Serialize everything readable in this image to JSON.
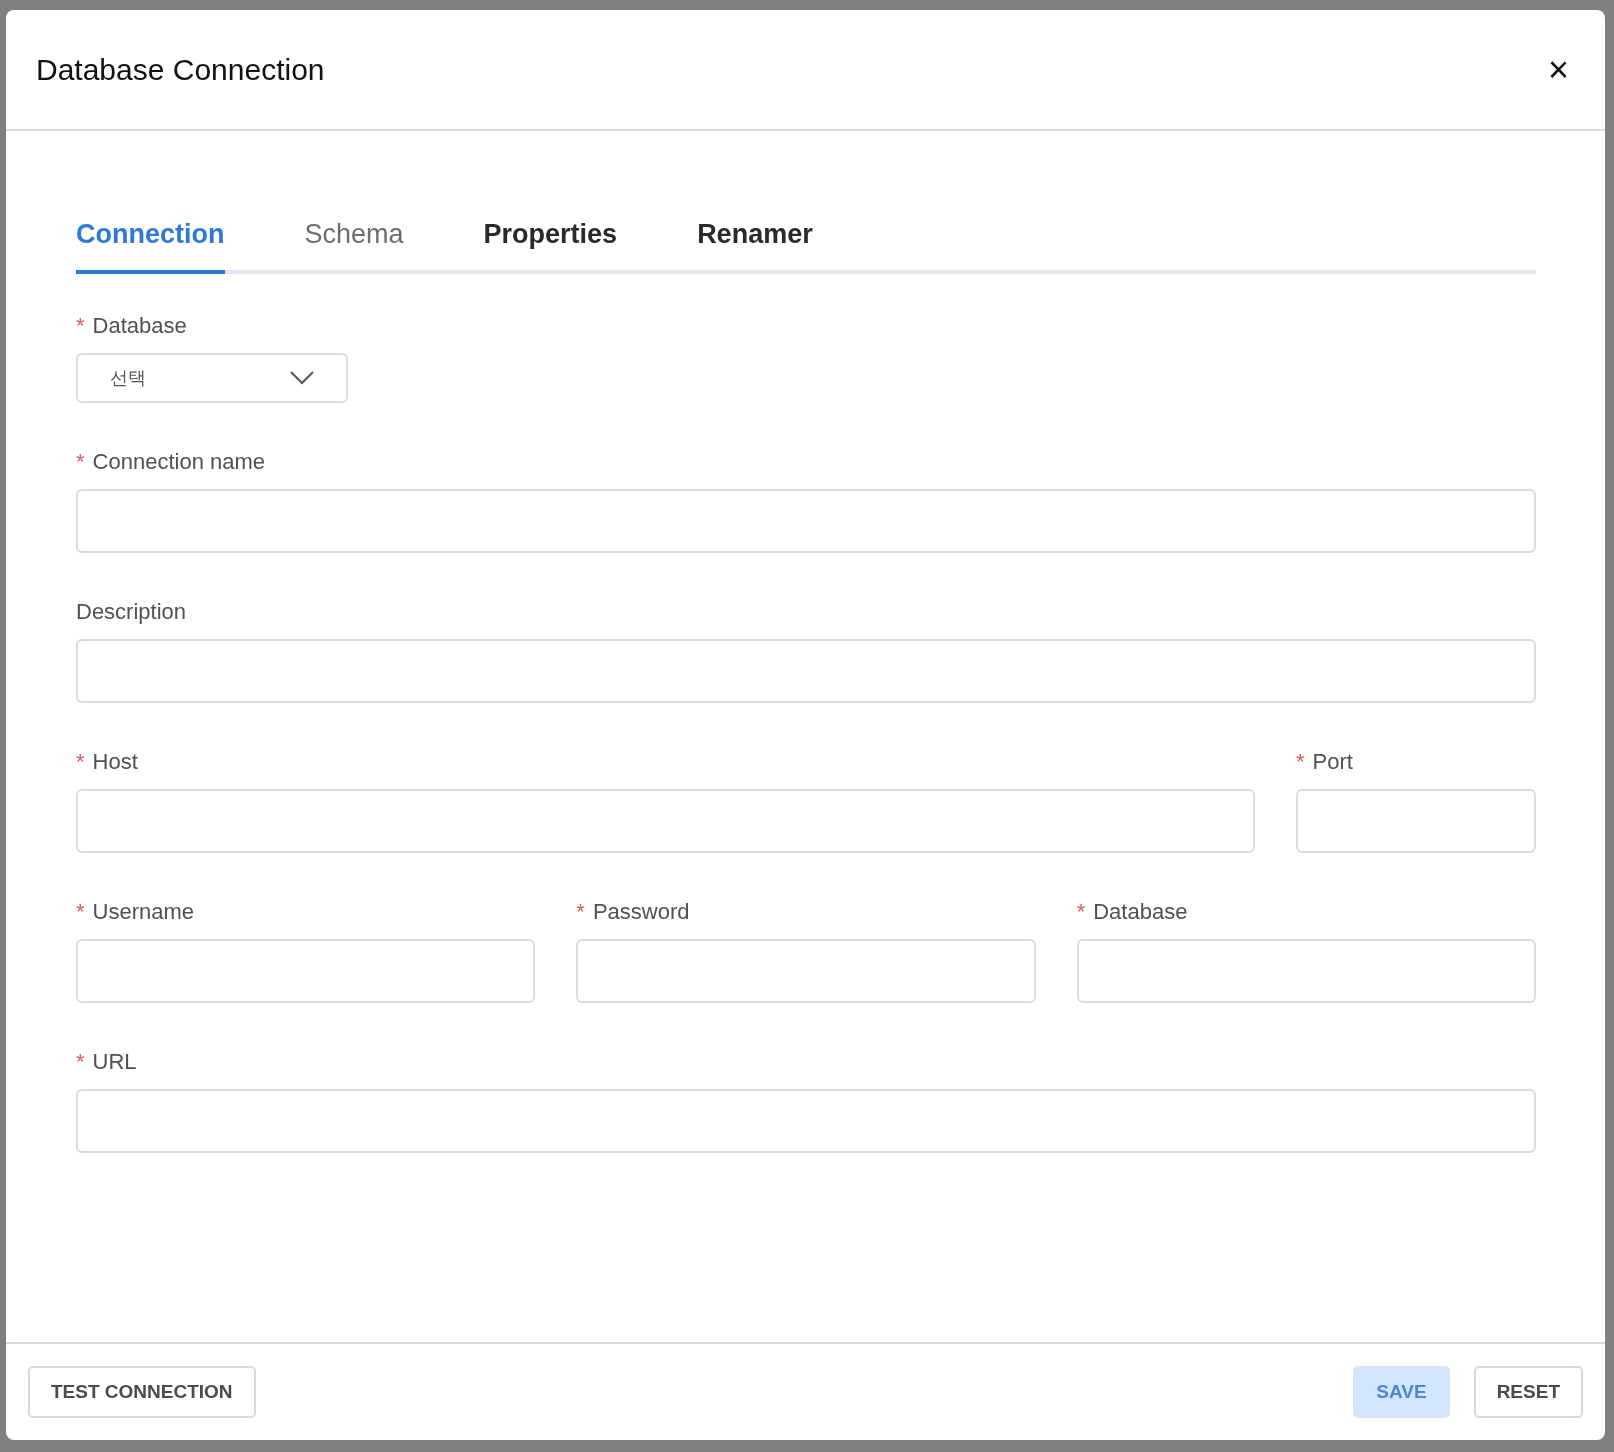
{
  "dialog": {
    "title": "Database Connection",
    "close": "×"
  },
  "tabs": [
    {
      "label": "Connection",
      "selected": true,
      "disabled": false
    },
    {
      "label": "Schema",
      "selected": false,
      "disabled": true
    },
    {
      "label": "Properties",
      "selected": false,
      "disabled": false
    },
    {
      "label": "Renamer",
      "selected": false,
      "disabled": false
    }
  ],
  "form_rows": [
    [
      {
        "label": "Database",
        "required": true,
        "kind": "select",
        "placeholder": "선택"
      }
    ],
    [
      {
        "label": "Connection name",
        "required": true,
        "kind": "text"
      }
    ],
    [
      {
        "label": "Description",
        "required": false,
        "kind": "text"
      }
    ],
    [
      {
        "label": "Host",
        "required": true,
        "kind": "text"
      },
      {
        "label": "Port",
        "required": true,
        "kind": "text"
      }
    ],
    [
      {
        "label": "Username",
        "required": true,
        "kind": "text"
      },
      {
        "label": "Password",
        "required": true,
        "kind": "text"
      },
      {
        "label": "Database",
        "required": true,
        "kind": "text"
      }
    ],
    [
      {
        "label": "URL",
        "required": true,
        "kind": "text"
      }
    ]
  ],
  "required_mark": "*",
  "footer": {
    "left": [
      {
        "label": "TEST CONNECTION",
        "disabled": false
      }
    ],
    "right": [
      {
        "label": "SAVE",
        "disabled": true,
        "kind": "primary"
      },
      {
        "label": "RESET",
        "disabled": false,
        "kind": "outline"
      }
    ]
  }
}
